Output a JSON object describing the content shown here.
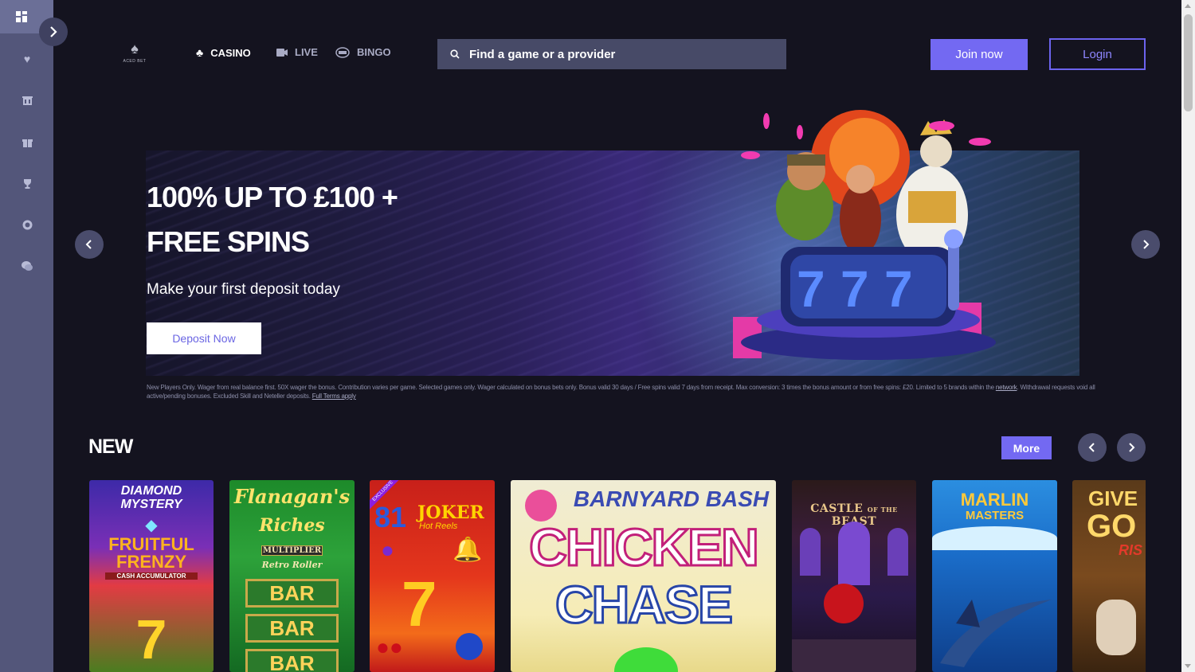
{
  "sidebar": {
    "items": [
      {
        "icon": "grid-icon"
      },
      {
        "icon": "heart-icon"
      },
      {
        "icon": "casino-building-icon"
      },
      {
        "icon": "gift-icon"
      },
      {
        "icon": "trophy-icon"
      },
      {
        "icon": "chip-icon"
      },
      {
        "icon": "support-chat-icon"
      }
    ],
    "expand_icon": "chevron-right-icon"
  },
  "header": {
    "logo_text": "ACED BET",
    "nav": [
      {
        "label": "CASINO",
        "icon": "clubs-icon"
      },
      {
        "label": "LIVE",
        "icon": "live-camera-icon"
      },
      {
        "label": "BINGO",
        "icon": "bingo-ball-icon"
      }
    ],
    "search_placeholder": "Find a game or a provider",
    "join_label": "Join now",
    "login_label": "Login"
  },
  "hero": {
    "title_line1": "100% UP TO £100 +",
    "title_line2": "FREE SPINS",
    "subtitle": "Make your first deposit today",
    "button_label": "Deposit Now",
    "slot_reels": [
      "7",
      "7",
      "7"
    ],
    "terms": "New Players Only. Wager from real balance first. 50X wager the bonus. Contribution varies per game. Selected games only. Wager calculated on bonus bets only. Bonus valid 30 days / Free spins valid 7 days from receipt. Max conversion: 3 times the bonus amount or from free spins: £20. Limited to 5 brands within the",
    "terms_link1": "network",
    "terms_mid": ". Withdrawal requests void all active/pending bonuses. Excluded Skill and Neteller deposits.",
    "terms_link2": "Full Terms apply"
  },
  "new_section": {
    "title": "NEW",
    "more_label": "More",
    "games": [
      {
        "title1": "DIAMOND",
        "title2": "MYSTERY",
        "title3": "FRUITFUL",
        "title4": "FRENZY",
        "title5": "CASH ACCUMULATOR"
      },
      {
        "title1": "Flanagan's",
        "title2": "Riches",
        "title3": "MULTIPLIER",
        "title4": "Retro Roller",
        "reel1": "BAR",
        "reel2": "BAR",
        "reel3": "BAR"
      },
      {
        "badge": "EXCLUSIVE",
        "title1": "81",
        "title2": "JOKER",
        "title3": "Hot Reels"
      },
      {
        "title1": "BARNYARD BASH",
        "title2": "CHICKEN",
        "title3": "CHASE"
      },
      {
        "title1": "CASTLE",
        "title2": "OF THE",
        "title3": "BEAST"
      },
      {
        "title1": "MARLIN",
        "title2": "MASTERS"
      },
      {
        "title1": "GIVE",
        "title2": "GO",
        "title3": "RIS"
      }
    ]
  },
  "colors": {
    "accent": "#7369f2",
    "sidebar": "#53567a",
    "background": "#14131f"
  }
}
